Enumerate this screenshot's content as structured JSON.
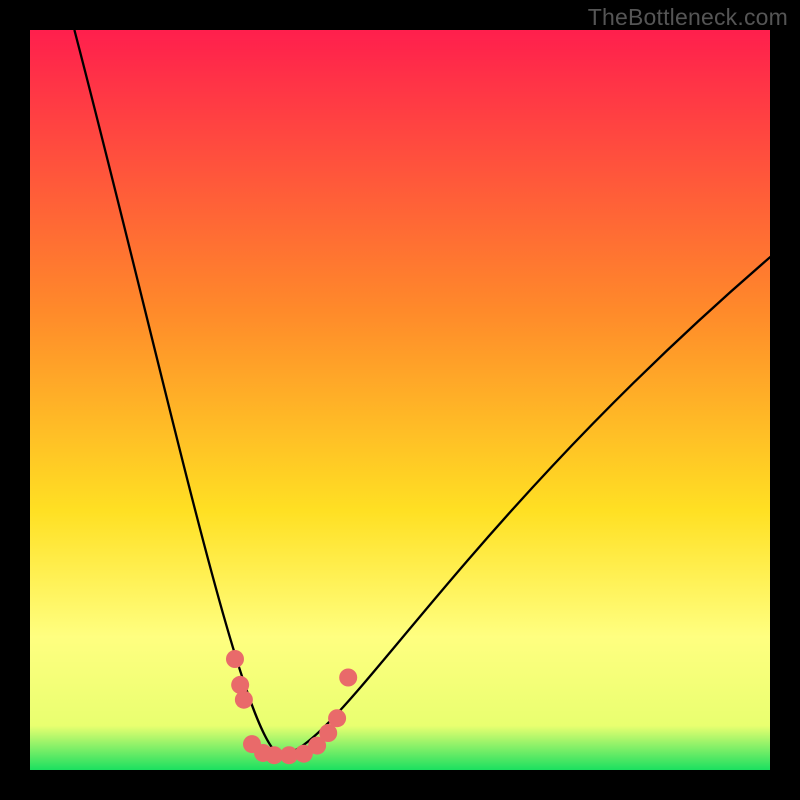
{
  "watermark": "TheBottleneck.com",
  "colors": {
    "frame": "#000000",
    "gradient_top": "#ff1f4d",
    "gradient_mid1": "#ff8a2a",
    "gradient_mid2": "#ffe023",
    "gradient_band": "#ffff80",
    "gradient_bottom": "#1be060",
    "curve_stroke": "#000000",
    "marker_fill": "#e96a6a",
    "marker_stroke": "#bf4a4a"
  },
  "chart_data": {
    "type": "line",
    "title": "",
    "xlabel": "",
    "ylabel": "",
    "xlim": [
      0,
      100
    ],
    "ylim": [
      0,
      100
    ],
    "grid": false,
    "legend": false,
    "curve": {
      "left_start": {
        "x": 6,
        "y": 100
      },
      "vertex": {
        "x": 34,
        "y": 2
      },
      "right_end": {
        "x": 102,
        "y": 71
      }
    },
    "markers": [
      {
        "x": 27.7,
        "y": 15.0
      },
      {
        "x": 28.4,
        "y": 11.5
      },
      {
        "x": 28.9,
        "y": 9.5
      },
      {
        "x": 30.0,
        "y": 3.5
      },
      {
        "x": 31.5,
        "y": 2.3
      },
      {
        "x": 33.0,
        "y": 2.0
      },
      {
        "x": 35.0,
        "y": 2.0
      },
      {
        "x": 37.0,
        "y": 2.2
      },
      {
        "x": 38.8,
        "y": 3.3
      },
      {
        "x": 40.3,
        "y": 5.0
      },
      {
        "x": 41.5,
        "y": 7.0
      },
      {
        "x": 43.0,
        "y": 12.5
      }
    ]
  }
}
